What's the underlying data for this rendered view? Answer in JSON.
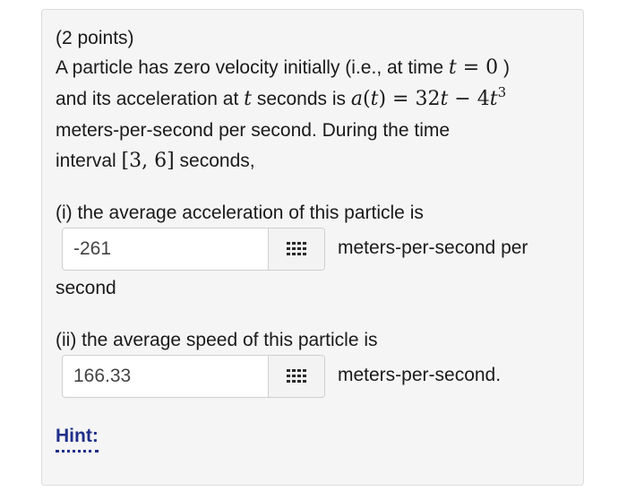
{
  "problem": {
    "points": "(2 points)",
    "line1_text": "A particle has zero velocity initially (i.e., at time",
    "line1_math_var": "t",
    "line1_math_rest": " = 0",
    "line1_close": " )",
    "line2_text_a": "and its acceleration at",
    "line2_math_var": "t",
    "line2_text_b": "seconds is",
    "line2_math_expr_a": "a",
    "line2_math_expr_b": "(",
    "line2_math_expr_c": "t",
    "line2_math_expr_d": ") = 32",
    "line2_math_expr_e": "t",
    "line2_math_expr_f": " − 4",
    "line2_math_expr_g": "t",
    "line2_math_exp": "3",
    "line3_text": "meters-per-second per second. During the time",
    "line4_text_a": "interval",
    "line4_math": "[3, 6]",
    "line4_text_b": "seconds,"
  },
  "part1": {
    "label": "(i) the average acceleration of this particle is",
    "answer_value": "-261",
    "unit_label": "meters-per-second per",
    "unit_continued": "second"
  },
  "part2": {
    "label": "(ii) the average speed of this particle is",
    "answer_value": "166.33",
    "unit_label": "meters-per-second."
  },
  "hint": {
    "label": "Hint:"
  },
  "icons": {
    "answer_button_icon": "grid-keypad-icon"
  },
  "colors": {
    "hint_link": "#1f2f8a",
    "card_background": "#f5f5f5"
  }
}
